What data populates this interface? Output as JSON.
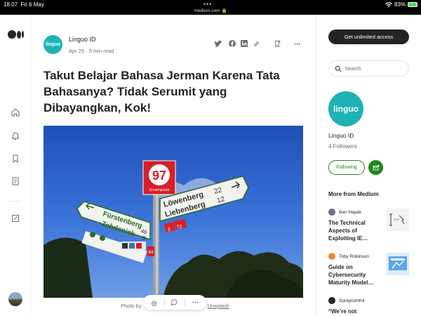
{
  "status_bar": {
    "time": "18.07",
    "date": "Fri 6 May",
    "url": "medium.com",
    "battery": "83%"
  },
  "rail": {
    "icons": [
      "medium-logo-icon",
      "home-icon",
      "bell-icon",
      "bookmark-icon",
      "document-icon",
      "pencil-icon"
    ]
  },
  "article": {
    "author": "Linguo ID",
    "author_logo_text": "linguo",
    "date": "Apr 25",
    "read_time": "5 min read",
    "meta_separator": "·",
    "title": "Takut Belajar Bahasa Jerman Karena Tata Bahasanya? Tidak Serumit yang Dibayangkan, Kok!",
    "caption_prefix": "Photo by",
    "caption_source": "Unsplash"
  },
  "hero_signs": {
    "route_number": "97",
    "route_sub": "Knotenpunkt",
    "left_sign_line1": "Fürstenberg",
    "left_sign_line2": "Zehdenick",
    "left_sign_km1": "46",
    "left_sign_km2": "5",
    "right_sign_line1": "Löwenberg",
    "right_sign_line2": "Liebenberg",
    "right_sign_km1": "22",
    "right_sign_km2": "12",
    "small_badge_1": "3",
    "small_badge_2": "72",
    "small_badge_3": "84"
  },
  "sidebar": {
    "cta": "Get unlimited access",
    "search_placeholder": "Search",
    "profile_logo_text": "linguo",
    "profile_name": "Linguo ID",
    "followers": "4 Followers",
    "following_label": "Following",
    "more_heading": "More from Medium",
    "stories": [
      {
        "author": "Ben Hayak",
        "title": "The Technical Aspects of Exploiting IE…"
      },
      {
        "author": "Toby Robinson",
        "title": "Guide on Cybersecurity Maturity Model…"
      },
      {
        "author": "Spraycontrol",
        "title": "“We’re not"
      }
    ]
  },
  "colors": {
    "accent_green": "#1a8917",
    "brand_teal": "#1eb2b5",
    "dark": "#242424"
  }
}
